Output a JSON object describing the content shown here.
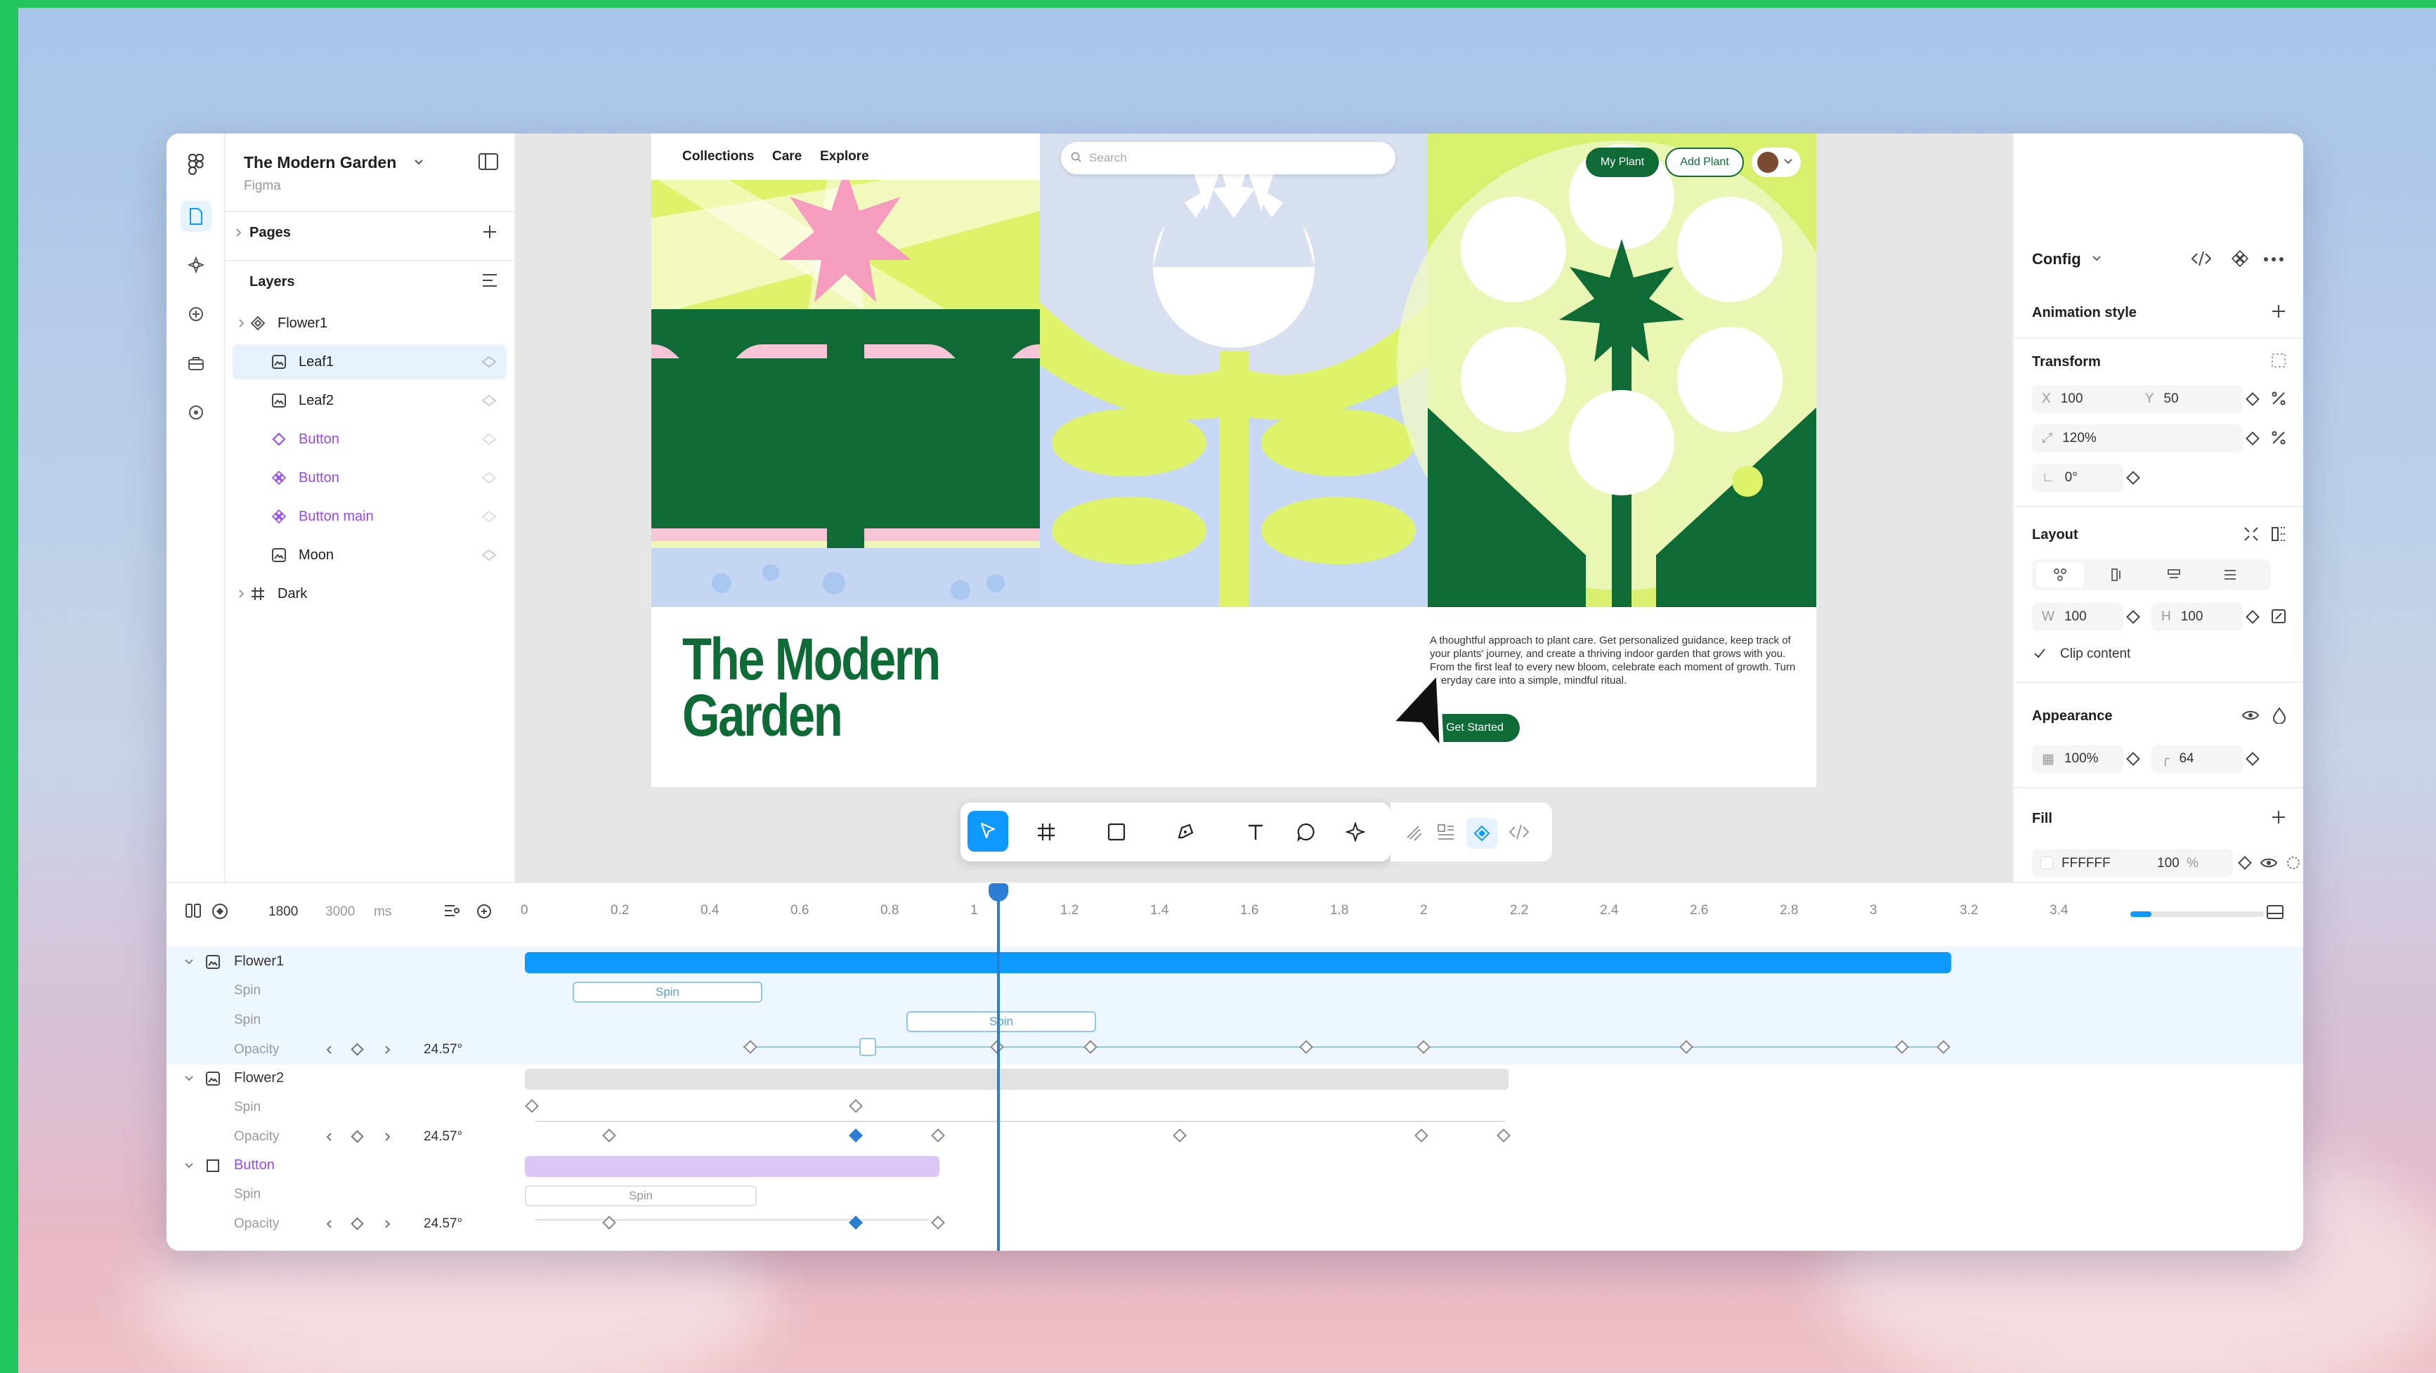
{
  "file": {
    "title": "The Modern Garden",
    "subtitle": "Figma"
  },
  "layers_panel": {
    "pages": "Pages",
    "layers": "Layers",
    "items": [
      {
        "label": "Flower1",
        "kind": "component-set",
        "depth": 0
      },
      {
        "label": "Leaf1",
        "kind": "image",
        "depth": 1,
        "selected": true
      },
      {
        "label": "Leaf2",
        "kind": "image",
        "depth": 1
      },
      {
        "label": "Button",
        "kind": "instance",
        "depth": 1
      },
      {
        "label": "Button",
        "kind": "component",
        "depth": 1
      },
      {
        "label": "Button main",
        "kind": "component",
        "depth": 1
      },
      {
        "label": "Moon",
        "kind": "image",
        "depth": 1
      },
      {
        "label": "Dark",
        "kind": "frame",
        "depth": 0
      }
    ]
  },
  "site": {
    "nav": [
      "Collections",
      "Care",
      "Explore"
    ],
    "search_placeholder": "Search",
    "btn_my_plant": "My Plant",
    "btn_add_plant": "Add Plant",
    "heading_line1": "The Modern",
    "heading_line2": "Garden",
    "description": "A thoughtful approach to plant care. Get personalized guidance, keep track of your plants' journey, and create a thriving indoor garden that grows with you. From the first leaf to every new bloom, celebrate each moment of growth. Turn everyday care into a simple, mindful ritual.",
    "cta": "Get Started"
  },
  "toolbar": {
    "tools": [
      "move-icon",
      "frame-icon",
      "rectangle-icon",
      "pen-icon",
      "text-icon",
      "comment-icon",
      "component-icon",
      "dev-icon",
      "layout-icon",
      "variable-icon",
      "code-icon"
    ]
  },
  "right_panel": {
    "config": "Config",
    "animation_style": "Animation style",
    "transform": "Transform",
    "x_label": "X",
    "x": "100",
    "y_label": "Y",
    "y": "50",
    "scale": "120%",
    "rotation": "0°",
    "layout": "Layout",
    "w_label": "W",
    "w": "100",
    "h_label": "H",
    "h": "100",
    "clip": "Clip content",
    "appearance": "Appearance",
    "opacity": "100%",
    "radius": "64",
    "fill": "Fill",
    "fill_hex": "FFFFFF",
    "fill_opacity": "100",
    "fill_pct": "%"
  },
  "timeline": {
    "frame": "1800",
    "duration": "3000",
    "unit": "ms",
    "playhead": 1.05,
    "ticks": [
      "0",
      "0.2",
      "0.4",
      "0.6",
      "0.8",
      "1",
      "1.2",
      "1.4",
      "1.6",
      "1.8",
      "2",
      "2.2",
      "2.4",
      "2.6",
      "2.8",
      "3",
      "3.2",
      "3.4"
    ],
    "rows": {
      "flower1": "Flower1",
      "spin": "Spin",
      "opacity": "Opacity",
      "opacity_value": "24.57°",
      "flower2": "Flower2",
      "button": "Button"
    },
    "clip_spin": "Spin"
  },
  "colors": {
    "accent": "#0d99ff",
    "brand_green": "#0e6b35",
    "lime": "#dff36a",
    "pink": "#f59cbf"
  }
}
